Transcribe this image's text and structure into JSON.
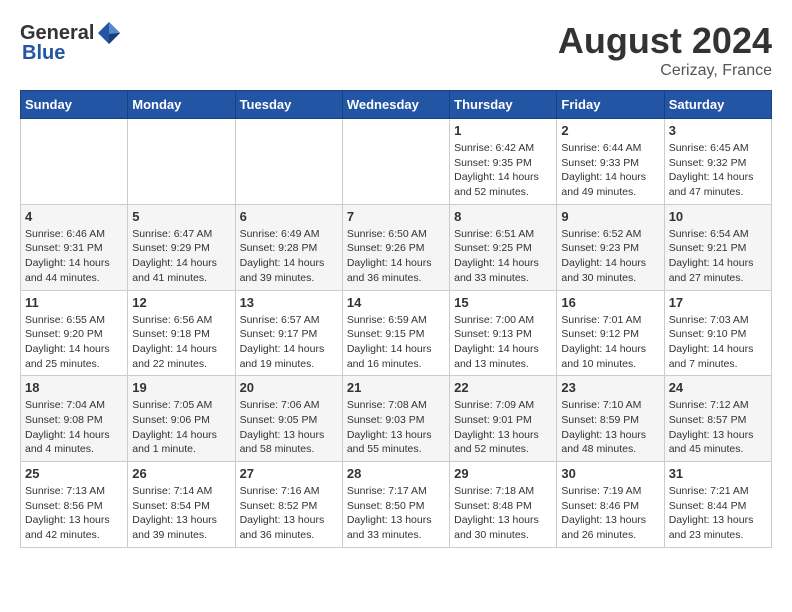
{
  "header": {
    "logo_general": "General",
    "logo_blue": "Blue",
    "month_year": "August 2024",
    "location": "Cerizay, France"
  },
  "days_of_week": [
    "Sunday",
    "Monday",
    "Tuesday",
    "Wednesday",
    "Thursday",
    "Friday",
    "Saturday"
  ],
  "weeks": [
    [
      {
        "day": "",
        "info": ""
      },
      {
        "day": "",
        "info": ""
      },
      {
        "day": "",
        "info": ""
      },
      {
        "day": "",
        "info": ""
      },
      {
        "day": "1",
        "info": "Sunrise: 6:42 AM\nSunset: 9:35 PM\nDaylight: 14 hours\nand 52 minutes."
      },
      {
        "day": "2",
        "info": "Sunrise: 6:44 AM\nSunset: 9:33 PM\nDaylight: 14 hours\nand 49 minutes."
      },
      {
        "day": "3",
        "info": "Sunrise: 6:45 AM\nSunset: 9:32 PM\nDaylight: 14 hours\nand 47 minutes."
      }
    ],
    [
      {
        "day": "4",
        "info": "Sunrise: 6:46 AM\nSunset: 9:31 PM\nDaylight: 14 hours\nand 44 minutes."
      },
      {
        "day": "5",
        "info": "Sunrise: 6:47 AM\nSunset: 9:29 PM\nDaylight: 14 hours\nand 41 minutes."
      },
      {
        "day": "6",
        "info": "Sunrise: 6:49 AM\nSunset: 9:28 PM\nDaylight: 14 hours\nand 39 minutes."
      },
      {
        "day": "7",
        "info": "Sunrise: 6:50 AM\nSunset: 9:26 PM\nDaylight: 14 hours\nand 36 minutes."
      },
      {
        "day": "8",
        "info": "Sunrise: 6:51 AM\nSunset: 9:25 PM\nDaylight: 14 hours\nand 33 minutes."
      },
      {
        "day": "9",
        "info": "Sunrise: 6:52 AM\nSunset: 9:23 PM\nDaylight: 14 hours\nand 30 minutes."
      },
      {
        "day": "10",
        "info": "Sunrise: 6:54 AM\nSunset: 9:21 PM\nDaylight: 14 hours\nand 27 minutes."
      }
    ],
    [
      {
        "day": "11",
        "info": "Sunrise: 6:55 AM\nSunset: 9:20 PM\nDaylight: 14 hours\nand 25 minutes."
      },
      {
        "day": "12",
        "info": "Sunrise: 6:56 AM\nSunset: 9:18 PM\nDaylight: 14 hours\nand 22 minutes."
      },
      {
        "day": "13",
        "info": "Sunrise: 6:57 AM\nSunset: 9:17 PM\nDaylight: 14 hours\nand 19 minutes."
      },
      {
        "day": "14",
        "info": "Sunrise: 6:59 AM\nSunset: 9:15 PM\nDaylight: 14 hours\nand 16 minutes."
      },
      {
        "day": "15",
        "info": "Sunrise: 7:00 AM\nSunset: 9:13 PM\nDaylight: 14 hours\nand 13 minutes."
      },
      {
        "day": "16",
        "info": "Sunrise: 7:01 AM\nSunset: 9:12 PM\nDaylight: 14 hours\nand 10 minutes."
      },
      {
        "day": "17",
        "info": "Sunrise: 7:03 AM\nSunset: 9:10 PM\nDaylight: 14 hours\nand 7 minutes."
      }
    ],
    [
      {
        "day": "18",
        "info": "Sunrise: 7:04 AM\nSunset: 9:08 PM\nDaylight: 14 hours\nand 4 minutes."
      },
      {
        "day": "19",
        "info": "Sunrise: 7:05 AM\nSunset: 9:06 PM\nDaylight: 14 hours\nand 1 minute."
      },
      {
        "day": "20",
        "info": "Sunrise: 7:06 AM\nSunset: 9:05 PM\nDaylight: 13 hours\nand 58 minutes."
      },
      {
        "day": "21",
        "info": "Sunrise: 7:08 AM\nSunset: 9:03 PM\nDaylight: 13 hours\nand 55 minutes."
      },
      {
        "day": "22",
        "info": "Sunrise: 7:09 AM\nSunset: 9:01 PM\nDaylight: 13 hours\nand 52 minutes."
      },
      {
        "day": "23",
        "info": "Sunrise: 7:10 AM\nSunset: 8:59 PM\nDaylight: 13 hours\nand 48 minutes."
      },
      {
        "day": "24",
        "info": "Sunrise: 7:12 AM\nSunset: 8:57 PM\nDaylight: 13 hours\nand 45 minutes."
      }
    ],
    [
      {
        "day": "25",
        "info": "Sunrise: 7:13 AM\nSunset: 8:56 PM\nDaylight: 13 hours\nand 42 minutes."
      },
      {
        "day": "26",
        "info": "Sunrise: 7:14 AM\nSunset: 8:54 PM\nDaylight: 13 hours\nand 39 minutes."
      },
      {
        "day": "27",
        "info": "Sunrise: 7:16 AM\nSunset: 8:52 PM\nDaylight: 13 hours\nand 36 minutes."
      },
      {
        "day": "28",
        "info": "Sunrise: 7:17 AM\nSunset: 8:50 PM\nDaylight: 13 hours\nand 33 minutes."
      },
      {
        "day": "29",
        "info": "Sunrise: 7:18 AM\nSunset: 8:48 PM\nDaylight: 13 hours\nand 30 minutes."
      },
      {
        "day": "30",
        "info": "Sunrise: 7:19 AM\nSunset: 8:46 PM\nDaylight: 13 hours\nand 26 minutes."
      },
      {
        "day": "31",
        "info": "Sunrise: 7:21 AM\nSunset: 8:44 PM\nDaylight: 13 hours\nand 23 minutes."
      }
    ]
  ]
}
